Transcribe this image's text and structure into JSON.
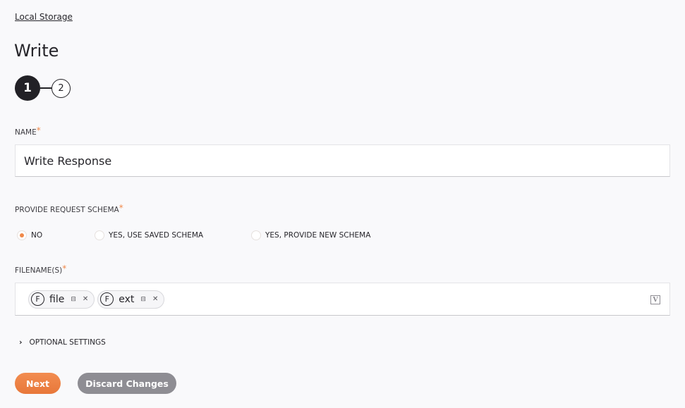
{
  "breadcrumb": "Local Storage",
  "title": "Write",
  "stepper": {
    "steps": [
      "1",
      "2"
    ],
    "active_step": 1
  },
  "name_field": {
    "label": "NAME",
    "required_marker": "*",
    "value": "Write Response"
  },
  "schema_field": {
    "label": "PROVIDE REQUEST SCHEMA",
    "required_marker": "*",
    "options": [
      "NO",
      "YES, USE SAVED SCHEMA",
      "YES, PROVIDE NEW SCHEMA"
    ],
    "selected": "NO"
  },
  "filenames_field": {
    "label": "FILENAME(S)",
    "required_marker": "*",
    "pills": [
      {
        "badge": "F",
        "text": "file"
      },
      {
        "badge": "F",
        "text": "ext"
      }
    ],
    "variable_icon_glyph": "V"
  },
  "optional_settings": {
    "label": "OPTIONAL SETTINGS",
    "chevron": "›"
  },
  "buttons": {
    "next": "Next",
    "discard": "Discard Changes"
  },
  "colors": {
    "accent": "#f0894a",
    "dark": "#222126",
    "discard": "#8e8d93",
    "background": "#f9f9fb"
  }
}
